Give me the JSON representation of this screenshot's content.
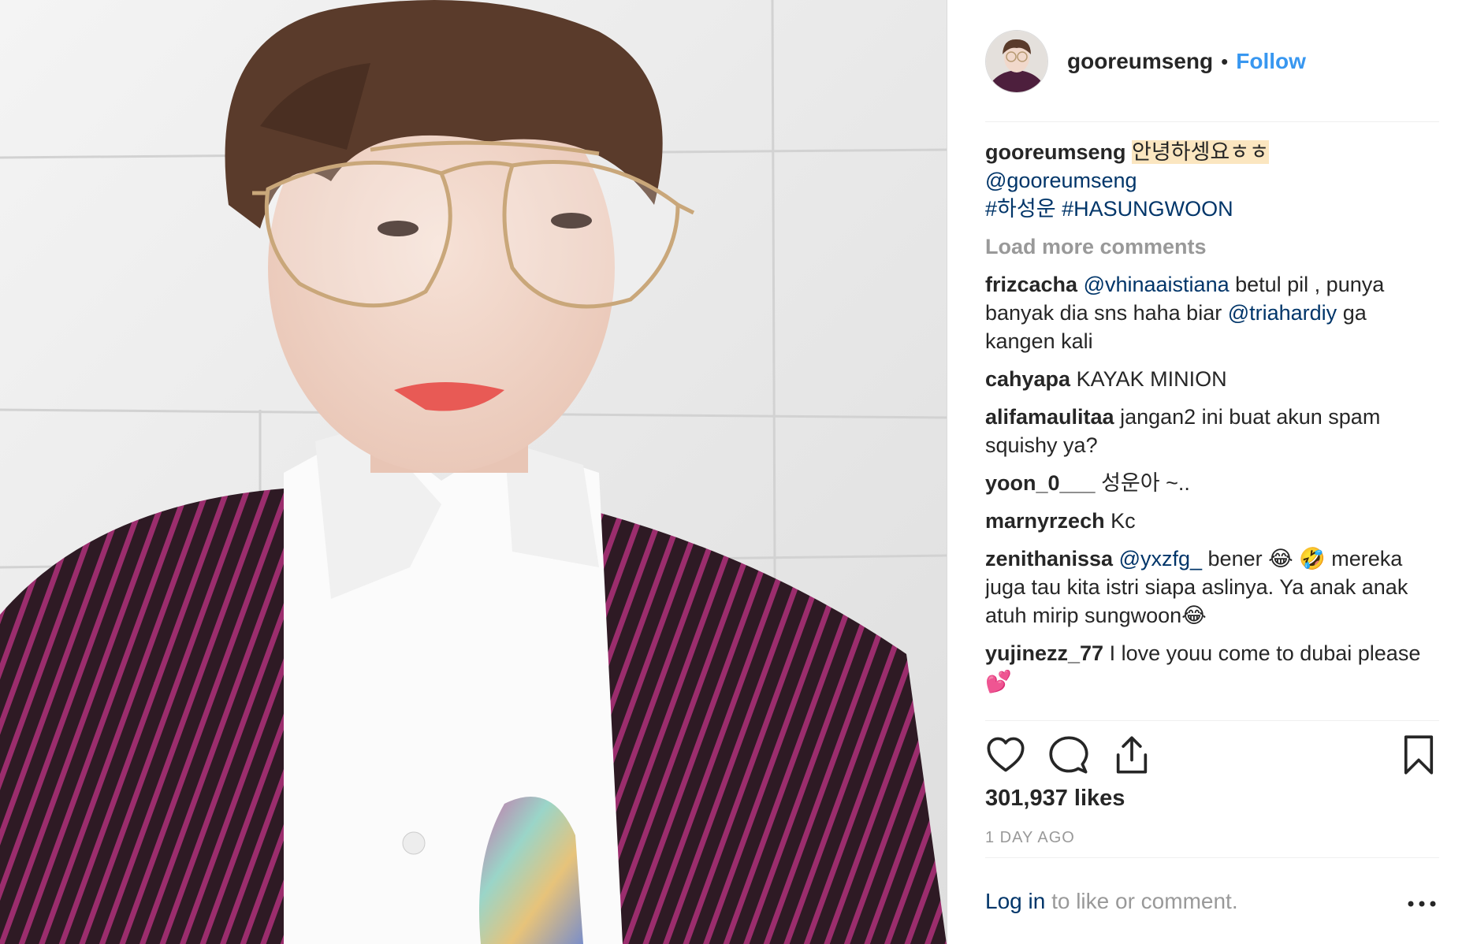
{
  "header": {
    "username": "gooreumseng",
    "separator": "•",
    "follow_label": "Follow"
  },
  "caption": {
    "username": "gooreumseng",
    "greeting": "안녕하셍요ㅎㅎ",
    "mention": "@gooreumseng",
    "hashtag1": "#하성운",
    "hashtag2": "#HASUNGWOON"
  },
  "load_more_label": "Load more comments",
  "comments": [
    {
      "user": "frizcacha",
      "mention": "@vhinaaistiana",
      "text1": " betul pil , punya banyak dia sns haha biar ",
      "mention2": "@triahardiy",
      "text2": " ga kangen kali"
    },
    {
      "user": "cahyapa",
      "text": " KAYAK MINION"
    },
    {
      "user": "alifamaulitaa",
      "text": " jangan2 ini buat akun spam squishy ya?"
    },
    {
      "user": "yoon_0___",
      "text": " 성운아 ~.."
    },
    {
      "user": "marnyrzech",
      "text": " Kc"
    },
    {
      "user": "zenithanissa",
      "mention": "@yxzfg_",
      "text": " bener 😂 🤣  mereka juga tau kita istri siapa aslinya. Ya anak anak atuh mirip sungwoon😂"
    },
    {
      "user": "yujinezz_77",
      "text": " I love youu come to dubai please 💕"
    }
  ],
  "likes_label": "301,937 likes",
  "time_label": "1 DAY AGO",
  "footer": {
    "login_label": "Log in",
    "rest_label": " to like or comment."
  },
  "icons": [
    "heart-icon",
    "comment-icon",
    "share-icon",
    "bookmark-icon",
    "more-options-icon"
  ],
  "colors": {
    "follow_blue": "#3897f0",
    "link_navy": "#003569",
    "muted_gray": "#999999",
    "text_dark": "#262626",
    "highlight": "#fbe6c0"
  }
}
